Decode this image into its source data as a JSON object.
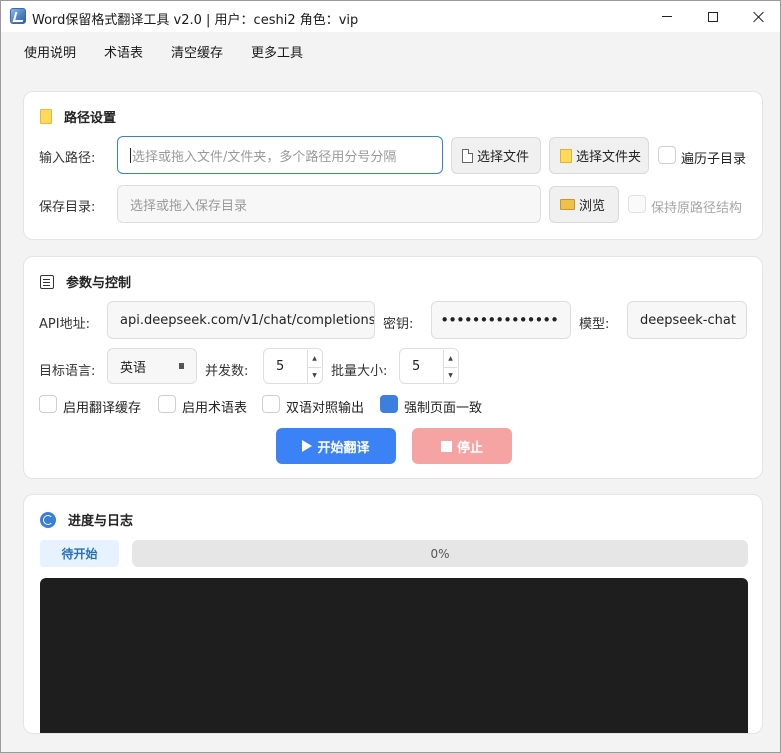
{
  "window": {
    "title": "Word保留格式翻译工具 v2.0  |  用户：ceshi2  角色：vip"
  },
  "menu": {
    "items": [
      "使用说明",
      "术语表",
      "清空缓存",
      "更多工具"
    ]
  },
  "path_section": {
    "title": "路径设置",
    "input_label": "输入路径:",
    "input_placeholder": "选择或拖入文件/文件夹，多个路径用分号分隔",
    "select_file_label": "选择文件",
    "select_folder_label": "选择文件夹",
    "recursive_label": "遍历子目录",
    "recursive_checked": false,
    "save_label": "保存目录:",
    "save_placeholder": "选择或拖入保存目录",
    "browse_label": "浏览",
    "keep_structure_label": "保持原路径结构",
    "keep_structure_checked": false
  },
  "param_section": {
    "title": "参数与控制",
    "api_label": "API地址:",
    "api_value": "api.deepseek.com/v1/chat/completions",
    "key_label": "密钥:",
    "key_value": "•••••••••••••••",
    "model_label": "模型:",
    "model_value": "deepseek-chat",
    "target_lang_label": "目标语言:",
    "target_lang_value": "英语",
    "concurrency_label": "并发数:",
    "concurrency_value": "5",
    "batch_label": "批量大小:",
    "batch_value": "5",
    "options": [
      {
        "label": "启用翻译缓存",
        "checked": false
      },
      {
        "label": "启用术语表",
        "checked": false
      },
      {
        "label": "双语对照输出",
        "checked": false
      },
      {
        "label": "强制页面一致",
        "checked": true
      }
    ],
    "start_label": "开始翻译",
    "stop_label": "停止"
  },
  "log_section": {
    "title": "进度与日志",
    "status": "待开始",
    "progress_text": "0%",
    "progress_value": 0
  },
  "colors": {
    "accent": "#3b82f6",
    "stop": "#f5a3a3",
    "log_bg": "#1e1e1e",
    "status_bg": "#e6f2ff",
    "status_text": "#2a6fba"
  }
}
